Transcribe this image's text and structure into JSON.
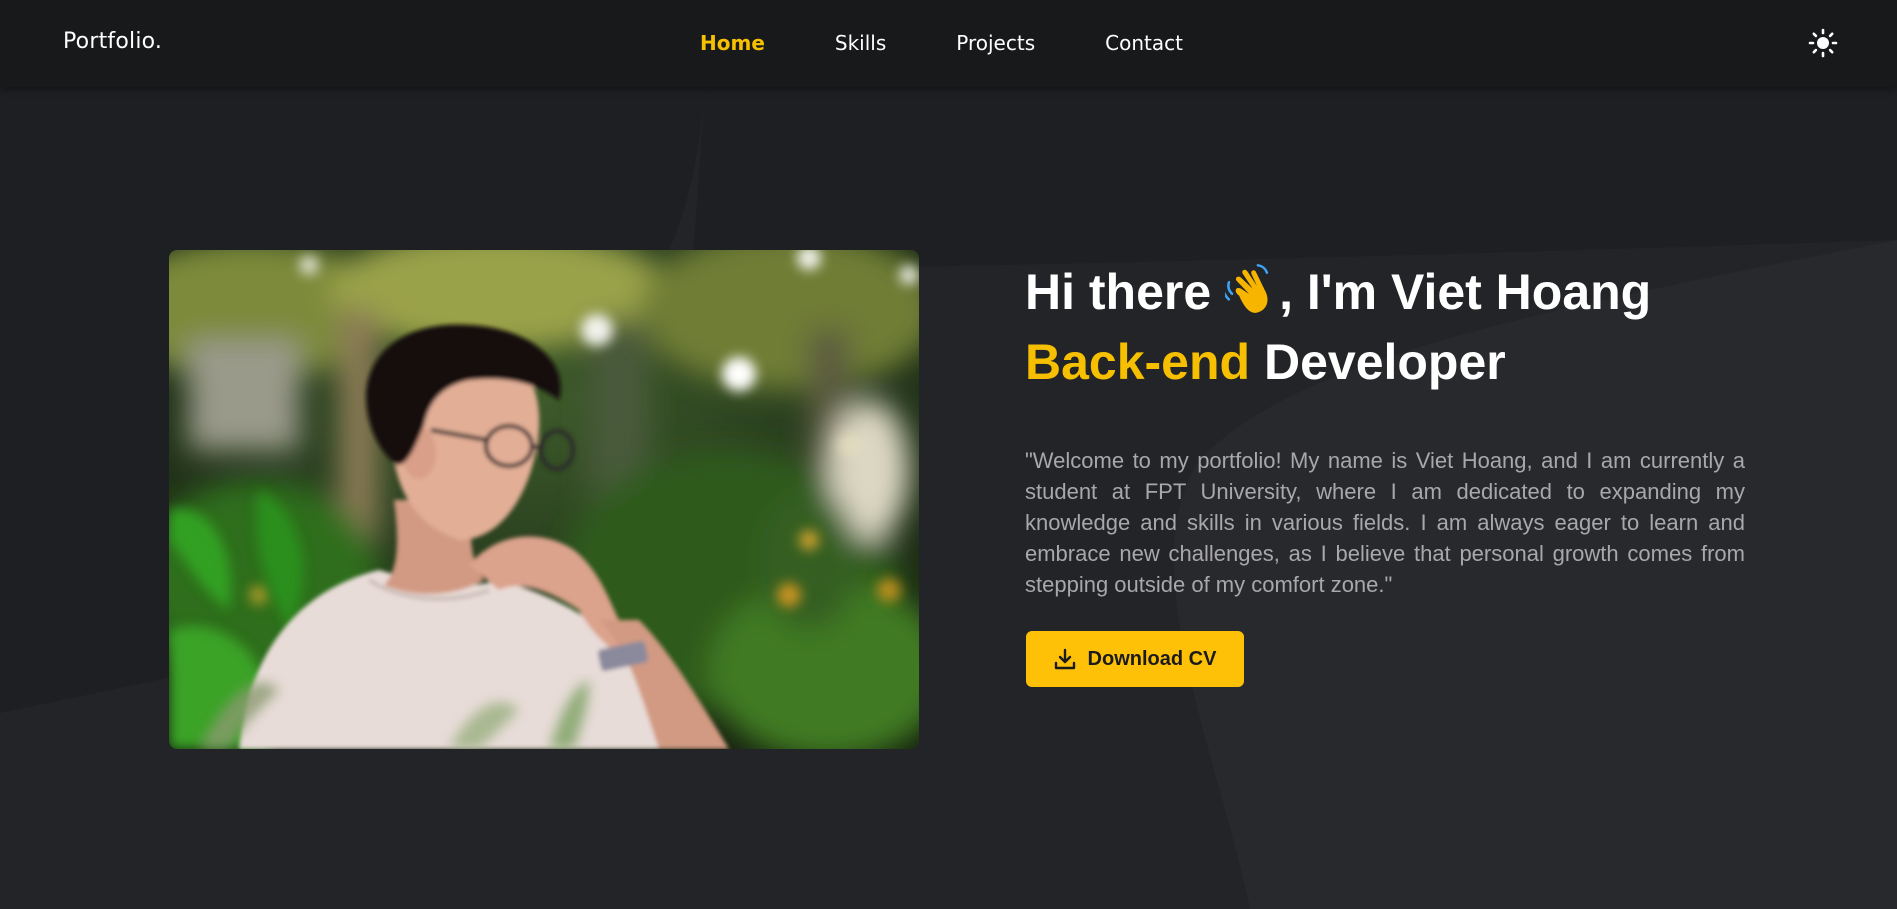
{
  "navbar": {
    "brand": "Portfolio.",
    "links": [
      {
        "label": "Home",
        "active": true
      },
      {
        "label": "Skills",
        "active": false
      },
      {
        "label": "Projects",
        "active": false
      },
      {
        "label": "Contact",
        "active": false
      }
    ],
    "theme_icon": "sun-icon"
  },
  "hero": {
    "greeting_before": "Hi there",
    "greeting_emoji": "waving-hand-icon",
    "greeting_after": ", I'm Viet Hoang",
    "role_accent": "Back-end",
    "role_rest": " Developer",
    "intro": "\"Welcome to my portfolio! My name is Viet Hoang, and I am currently a student at FPT University, where I am dedicated to expanding my knowledge and skills in various fields. I am always eager to learn and embrace new challenges, as I believe that personal growth comes from stepping outside of my comfort zone.\"",
    "cv_button": {
      "label": "Download CV",
      "icon": "download-icon"
    },
    "photo": "portrait-photo"
  },
  "colors": {
    "accent": "#f6c000",
    "button": "#ffc107",
    "background": "#1e1f22",
    "navbar": "#18191b",
    "text": "#ffffff",
    "muted_text": "#a8a8ab"
  }
}
